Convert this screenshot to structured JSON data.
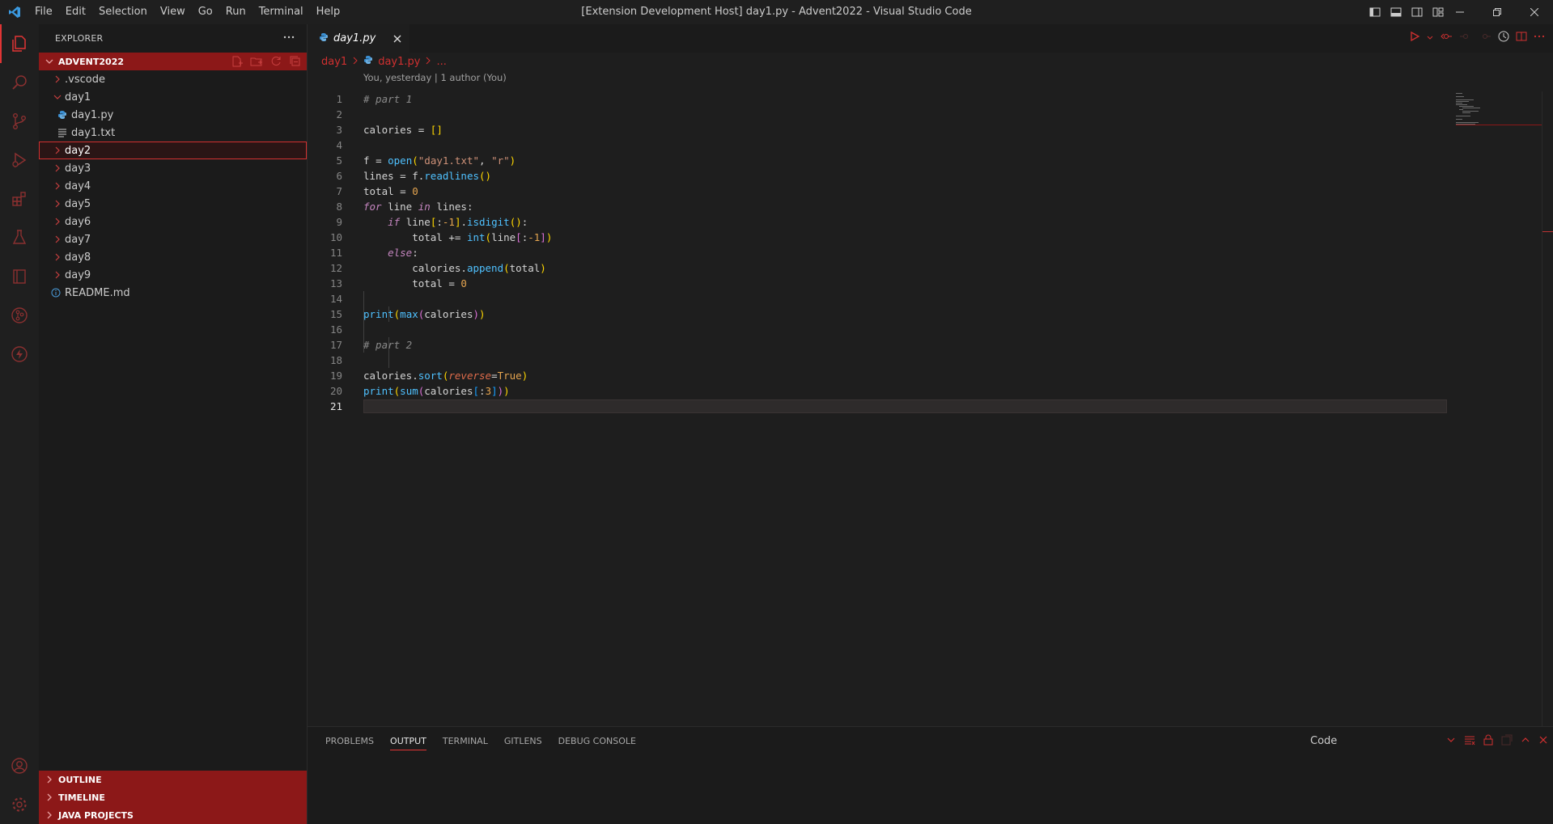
{
  "titlebar": {
    "menus": [
      "File",
      "Edit",
      "Selection",
      "View",
      "Go",
      "Run",
      "Terminal",
      "Help"
    ],
    "title": "[Extension Development Host] day1.py - Advent2022 - Visual Studio Code"
  },
  "activitybar": {
    "items": [
      "explorer-icon",
      "search-icon",
      "source-control-icon",
      "run-debug-icon",
      "extensions-icon",
      "testing-icon",
      "remote-explorer-icon",
      "gitlens-icon",
      "lightning-icon"
    ],
    "bottom": [
      "account-icon",
      "manage-gear-icon"
    ]
  },
  "sidebar": {
    "title": "EXPLORER",
    "workspace": "ADVENT2022",
    "tree": [
      {
        "label": ".vscode",
        "type": "folder",
        "expanded": false,
        "depth": 0
      },
      {
        "label": "day1",
        "type": "folder",
        "expanded": true,
        "depth": 0
      },
      {
        "label": "day1.py",
        "type": "python",
        "depth": 1
      },
      {
        "label": "day1.txt",
        "type": "text",
        "depth": 1
      },
      {
        "label": "day2",
        "type": "folder",
        "expanded": false,
        "depth": 0,
        "selected": true
      },
      {
        "label": "day3",
        "type": "folder",
        "expanded": false,
        "depth": 0
      },
      {
        "label": "day4",
        "type": "folder",
        "expanded": false,
        "depth": 0
      },
      {
        "label": "day5",
        "type": "folder",
        "expanded": false,
        "depth": 0
      },
      {
        "label": "day6",
        "type": "folder",
        "expanded": false,
        "depth": 0
      },
      {
        "label": "day7",
        "type": "folder",
        "expanded": false,
        "depth": 0
      },
      {
        "label": "day8",
        "type": "folder",
        "expanded": false,
        "depth": 0
      },
      {
        "label": "day9",
        "type": "folder",
        "expanded": false,
        "depth": 0
      },
      {
        "label": "README.md",
        "type": "info",
        "depth": 0
      }
    ],
    "sections": [
      "OUTLINE",
      "TIMELINE",
      "JAVA PROJECTS"
    ]
  },
  "editor": {
    "tab_label": "day1.py",
    "breadcrumb": {
      "folder": "day1",
      "file": "day1.py",
      "more": "..."
    },
    "blame": "You, yesterday | 1 author (You)",
    "current_line": 21
  },
  "panel": {
    "tabs": [
      "PROBLEMS",
      "OUTPUT",
      "TERMINAL",
      "GITLENS",
      "DEBUG CONSOLE"
    ],
    "active_tab": "OUTPUT",
    "channel": "Code"
  },
  "colors": {
    "accent": "#e03535",
    "section_header": "#8c1818"
  }
}
